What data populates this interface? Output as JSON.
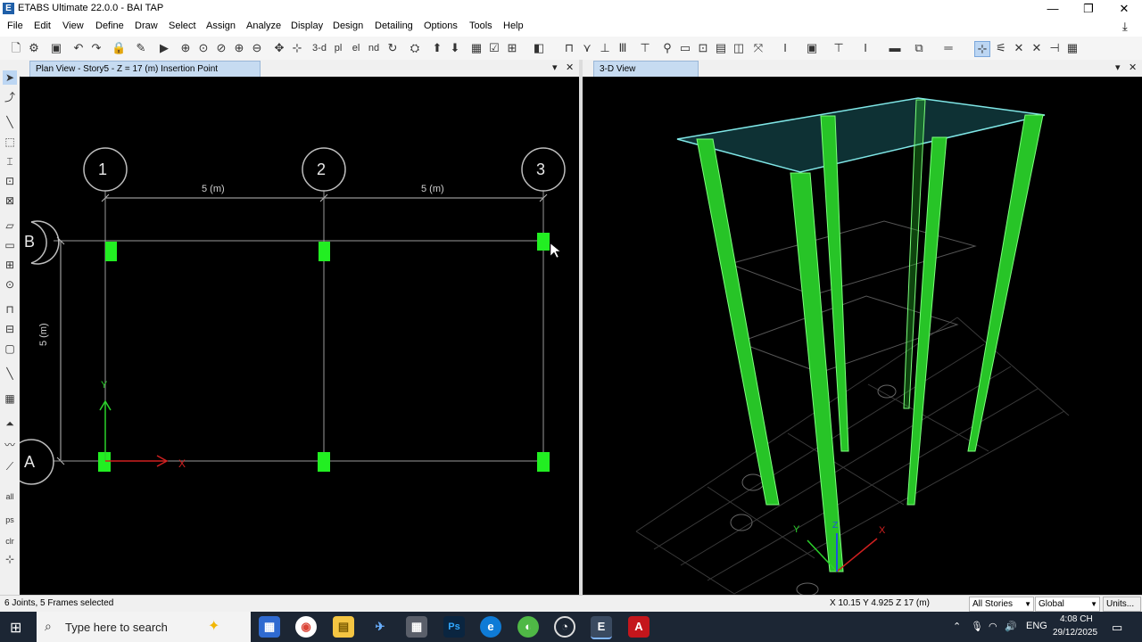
{
  "window": {
    "title": "ETABS Ultimate 22.0.0 - BAI TAP",
    "app_icon": "E",
    "minimize": "—",
    "restore": "❐",
    "close": "✕"
  },
  "menu": [
    "File",
    "Edit",
    "View",
    "Define",
    "Draw",
    "Select",
    "Assign",
    "Analyze",
    "Display",
    "Design",
    "Detailing",
    "Options",
    "Tools",
    "Help"
  ],
  "plan_view": {
    "tab_label": "Plan View - Story5 - Z = 17 (m)  Insertion Point",
    "grid_x": [
      "1",
      "2",
      "3"
    ],
    "grid_y": [
      "B",
      "A"
    ],
    "dim_1_2": "5 (m)",
    "dim_2_3": "5 (m)",
    "dim_a_b": "5 (m)",
    "axis_x": "X",
    "axis_y": "Y"
  },
  "view3d": {
    "tab_label": "3-D View",
    "axis_x": "X",
    "axis_y": "Y",
    "axis_z": "Z"
  },
  "status": {
    "selection": "6 Joints, 5 Frames selected",
    "coords": "X 10.15  Y 4.925  Z 17 (m)",
    "stories": "All Stories",
    "system": "Global",
    "units": "Units..."
  },
  "taskbar": {
    "search_placeholder": "Type here to search",
    "lang": "ENG",
    "time": "4:08 CH",
    "date": "29/12/2025",
    "photoshop": "Ps"
  },
  "colors": {
    "frame_green": "#22ee22",
    "viewport_bg": "#000000",
    "tab_active": "#c6dbf1"
  }
}
